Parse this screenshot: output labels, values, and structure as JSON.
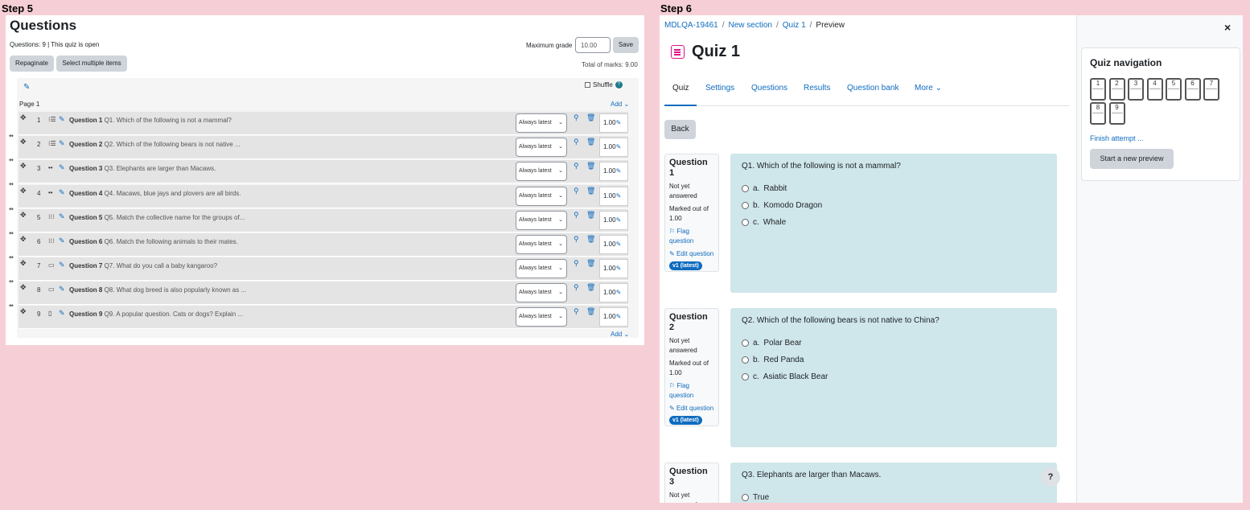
{
  "steps": {
    "left": "Step 5",
    "right": "Step 6"
  },
  "left": {
    "title": "Questions",
    "info": "Questions: 9 | This quiz is open",
    "max_grade_label": "Maximum grade",
    "max_grade_value": "10.00",
    "save_label": "Save",
    "repaginate_label": "Repaginate",
    "select_multiple_label": "Select multiple items",
    "total_marks": "Total of marks: 9.00",
    "shuffle_label": "Shuffle",
    "page_label": "Page 1",
    "add_label": "Add",
    "questions": [
      {
        "num": "1",
        "icon": "⁝☰",
        "title": "Question 1",
        "text": "Q1. Which of the following is not a mammal?",
        "version": "Always latest",
        "mark": "1.00"
      },
      {
        "num": "2",
        "icon": "⁝☰",
        "title": "Question 2",
        "text": "Q2. Which of the following bears is not native ...",
        "version": "Always latest",
        "mark": "1.00"
      },
      {
        "num": "3",
        "icon": "••",
        "title": "Question 3",
        "text": "Q3. Elephants are larger than Macaws.",
        "version": "Always latest",
        "mark": "1.00"
      },
      {
        "num": "4",
        "icon": "••",
        "title": "Question 4",
        "text": "Q4. Macaws, blue jays and plovers are all birds.",
        "version": "Always latest",
        "mark": "1.00"
      },
      {
        "num": "5",
        "icon": "⁝⁝⁝",
        "title": "Question 5",
        "text": "Q5. Match the collective name for the groups of...",
        "version": "Always latest",
        "mark": "1.00"
      },
      {
        "num": "6",
        "icon": "⁝⁝⁝",
        "title": "Question 6",
        "text": "Q6. Match the following animals to their mates.",
        "version": "Always latest",
        "mark": "1.00"
      },
      {
        "num": "7",
        "icon": "▭",
        "title": "Question 7",
        "text": "Q7. What do you call a baby kangaroo?",
        "version": "Always latest",
        "mark": "1.00"
      },
      {
        "num": "8",
        "icon": "▭",
        "title": "Question 8",
        "text": "Q8. What dog breed is also popularly known as ...",
        "version": "Always latest",
        "mark": "1.00"
      },
      {
        "num": "9",
        "icon": "▯",
        "title": "Question 9",
        "text": "Q9. A popular question. Cats or dogs? Explain ...",
        "version": "Always latest",
        "mark": "1.00"
      }
    ]
  },
  "right": {
    "breadcrumb": [
      "MDLQA-19461",
      "New section",
      "Quiz 1",
      "Preview"
    ],
    "quiz_title": "Quiz 1",
    "tabs": [
      "Quiz",
      "Settings",
      "Questions",
      "Results",
      "Question bank",
      "More"
    ],
    "back_label": "Back",
    "questions": [
      {
        "label": "Question",
        "num": "1",
        "status": "Not yet answered",
        "marked": "Marked out of 1.00",
        "flag": "Flag question",
        "edit": "Edit question",
        "badge": "v1 (latest)",
        "text": "Q1. Which of the following is not a mammal?",
        "options": [
          {
            "letter": "a.",
            "text": "Rabbit"
          },
          {
            "letter": "b.",
            "text": "Komodo Dragon"
          },
          {
            "letter": "c.",
            "text": "Whale"
          }
        ]
      },
      {
        "label": "Question",
        "num": "2",
        "status": "Not yet answered",
        "marked": "Marked out of 1.00",
        "flag": "Flag question",
        "edit": "Edit question",
        "badge": "v1 (latest)",
        "text": "Q2. Which of the following bears is not native to China?",
        "options": [
          {
            "letter": "a.",
            "text": "Polar Bear"
          },
          {
            "letter": "b.",
            "text": "Red Panda"
          },
          {
            "letter": "c.",
            "text": "Asiatic Black Bear"
          }
        ]
      },
      {
        "label": "Question",
        "num": "3",
        "status": "Not yet answered",
        "text": "Q3. Elephants are larger than Macaws.",
        "options": [
          {
            "letter": "",
            "text": "True"
          }
        ]
      }
    ],
    "help": "?",
    "close": "×",
    "nav": {
      "title": "Quiz navigation",
      "buttons": [
        "1",
        "2",
        "3",
        "4",
        "5",
        "6",
        "7",
        "8",
        "9"
      ],
      "finish": "Finish attempt ...",
      "new_preview": "Start a new preview"
    }
  }
}
